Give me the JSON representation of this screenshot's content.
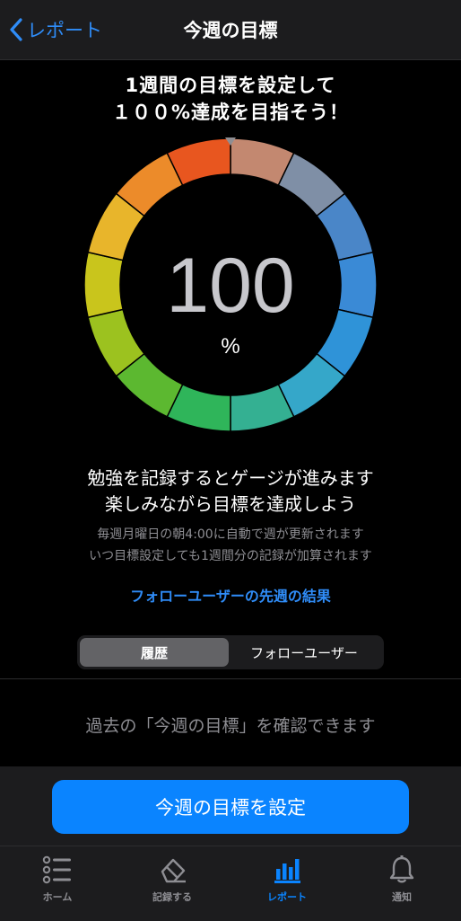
{
  "nav": {
    "back_label": "レポート",
    "title": "今週の目標"
  },
  "headline": {
    "line1": "1週間の目標を設定して",
    "line2": "１００%達成を目指そう！"
  },
  "gauge": {
    "value": "100",
    "unit": "%",
    "progress_percent": 100
  },
  "description": {
    "line1": "勉強を記録するとゲージが進みます",
    "line2": "楽しみながら目標を達成しよう",
    "note1": "毎週月曜日の朝4:00に自動で週が更新されます",
    "note2": "いつ目標設定しても1週間分の記録が加算されます"
  },
  "follow_link": "フォローユーザーの先週の結果",
  "segmented": {
    "history": "履歴",
    "follow_users": "フォローユーザー"
  },
  "empty_message": "過去の「今週の目標」を確認できます",
  "primary_button": "今週の目標を設定",
  "tabs": [
    {
      "label": "ホーム",
      "icon": "list-icon"
    },
    {
      "label": "記録する",
      "icon": "eraser-icon"
    },
    {
      "label": "レポート",
      "icon": "bar-chart-icon"
    },
    {
      "label": "通知",
      "icon": "bell-icon"
    }
  ],
  "colors": {
    "accent": "#0a84ff",
    "link": "#2f8cf7",
    "gauge_segments": [
      "#e8561f",
      "#7f8fa6",
      "#4a86c8",
      "#3a8ad6",
      "#2f93d8",
      "#35a7c9",
      "#34b092",
      "#2fb55a",
      "#5cb830",
      "#9cc21f",
      "#c9c51c",
      "#e8b52b",
      "#ec8b2a"
    ]
  }
}
